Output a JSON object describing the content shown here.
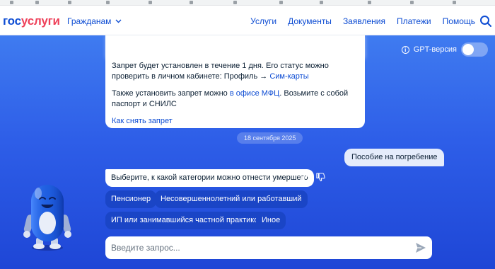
{
  "header": {
    "logo_part1": "гос",
    "logo_part2": "услуги",
    "citizens_label": "Гражданам",
    "nav": [
      "Услуги",
      "Документы",
      "Заявления",
      "Платежи",
      "Помощь"
    ],
    "icons": {
      "search": "search-icon",
      "chevron": "chevron-down-icon"
    }
  },
  "gpt": {
    "label": "GPT-версия",
    "enabled": false
  },
  "messages": {
    "bot1": {
      "line1": "Запрет будет установлен в течение 1 дня. Его статус можно проверить в личном кабинете: Профиль → ",
      "link1": "Сим-карты",
      "line2a": "Также установить запрет можно ",
      "link2": "в офисе МФЦ",
      "line2b": ". Возьмите с собой паспорт и СНИЛС",
      "link3": "Как снять запрет"
    },
    "date": "18 сентября 2025",
    "user": "Пособие на погребение",
    "bot2": "Выберите, к какой категории можно отнести умершего"
  },
  "options": [
    "Пенсионер",
    "Несовершеннолетний или работавший",
    "ИП или занимавшийся частной практикой",
    "Иное"
  ],
  "input": {
    "placeholder": "Введите запрос...",
    "value": ""
  },
  "colors": {
    "brand_blue": "#0d4cd3",
    "brand_red": "#ee3f58",
    "chip": "#1a45c6",
    "chat_bg": "#2e5ee8"
  }
}
